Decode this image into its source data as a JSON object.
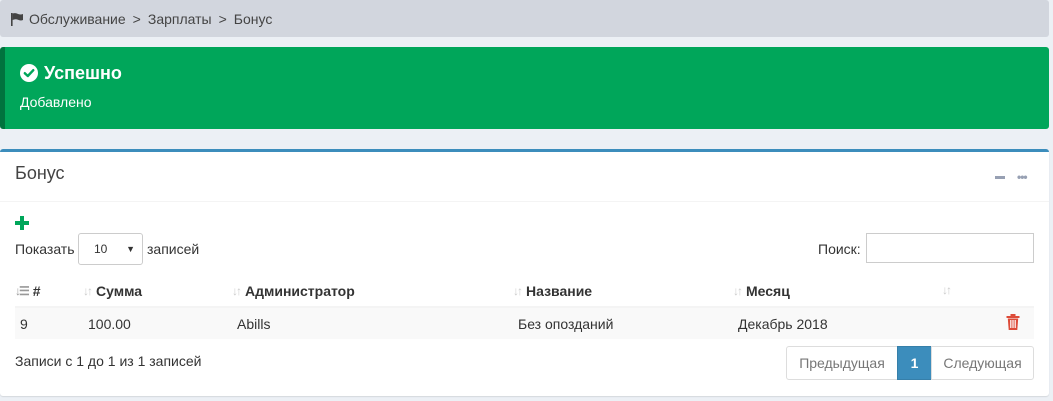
{
  "breadcrumb": {
    "icon": "flag-icon",
    "items": [
      "Обслуживание",
      "Зарплаты",
      "Бонус"
    ],
    "separator": ">"
  },
  "alert": {
    "icon": "check-circle-icon",
    "title": "Успешно",
    "message": "Добавлено",
    "color": "#00a65a"
  },
  "box": {
    "title": "Бонус",
    "add_icon": "plus-icon",
    "length": {
      "label": "Показать",
      "value": "10",
      "suffix": "записей"
    },
    "search": {
      "label": "Поиск:",
      "value": ""
    },
    "columns": [
      "#",
      "Сумма",
      "Администратор",
      "Название",
      "Месяц",
      ""
    ],
    "rows": [
      {
        "id": "9",
        "amount": "100.00",
        "admin": "Abills",
        "name": "Без опозданий",
        "month": "Декабрь 2018",
        "action_icon": "trash-icon"
      }
    ],
    "info": "Записи с 1 до 1 из 1 записей",
    "pagination": {
      "prev": "Предыдущая",
      "current": "1",
      "next": "Следующая"
    },
    "accent_color": "#3c8dbc"
  }
}
